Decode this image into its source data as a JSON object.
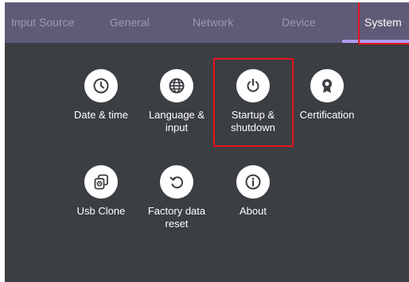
{
  "tabs": [
    {
      "label": "Input Source"
    },
    {
      "label": "General"
    },
    {
      "label": "Network"
    },
    {
      "label": "Device"
    },
    {
      "label": "System",
      "active": true
    }
  ],
  "items": [
    {
      "label": "Date & time",
      "icon": "clock-icon"
    },
    {
      "label": "Language &\ninput",
      "icon": "globe-icon"
    },
    {
      "label": "Startup &\nshutdown",
      "icon": "power-icon",
      "highlighted": true
    },
    {
      "label": "Certification",
      "icon": "award-ribbon-icon"
    },
    {
      "label": "Usb Clone",
      "icon": "usb-clone-icon"
    },
    {
      "label": "Factory data\nreset",
      "icon": "reset-icon"
    },
    {
      "label": "About",
      "icon": "info-icon"
    }
  ],
  "colors": {
    "tabbar_bg": "#5f5a75",
    "tab_inactive_text": "#9e98b4",
    "tab_active_text": "#ffffff",
    "tab_underline": "#b19bff",
    "content_bg": "#3b3e42",
    "icon_circle": "#ffffff",
    "icon_glyph": "#3b3e42",
    "highlight_border": "#e4141d"
  }
}
